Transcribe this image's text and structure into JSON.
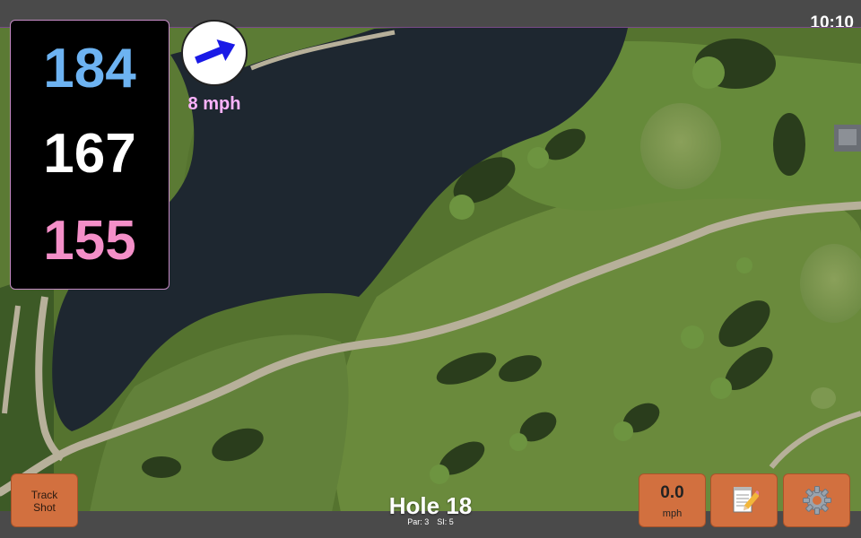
{
  "status_bar": {
    "time": "10:10"
  },
  "distances": {
    "back": "184",
    "middle": "167",
    "front": "155",
    "colors": {
      "back": "#6db3f2",
      "middle": "#ffffff",
      "front": "#f48fc8"
    }
  },
  "wind": {
    "speed": "8 mph",
    "direction_icon": "arrow-up-right-icon",
    "color": "#ffb3ff",
    "arrow_color": "#1a1ae6"
  },
  "hole": {
    "title": "Hole 18",
    "par": "Par: 3",
    "stroke_index": "SI: 5"
  },
  "buttons": {
    "track_shot": "Track\nShot",
    "speed_value": "0.0",
    "speed_unit": "mph",
    "notes_icon": "notepad-pencil-icon",
    "settings_icon": "gear-icon"
  },
  "colors": {
    "button_bg": "#d2703f",
    "panel_bg": "#000000",
    "bar_bg": "#4a4a4a"
  }
}
